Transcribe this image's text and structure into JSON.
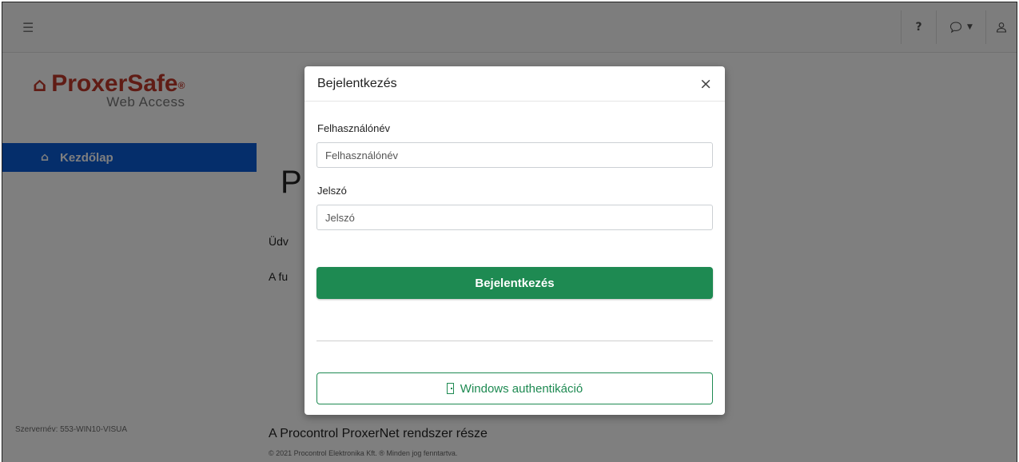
{
  "topbar": {
    "menu_icon": "hamburger-icon",
    "help_label": "?",
    "chat_icon": "chat-bubble-icon",
    "user_icon": "user-icon"
  },
  "sidebar": {
    "logo_main": "ProxerSafe",
    "logo_reg": "®",
    "logo_sub": "Web Access",
    "home_label": "Kezdőlap",
    "server_text": "Szervernév: 553-WIN10-VISUA"
  },
  "main": {
    "title_partial": "P",
    "welcome_partial": "Üdv",
    "func_partial": "A fu",
    "footer_main": "A Procontrol ProxerNet rendszer része",
    "footer_copy": "© 2021 Procontrol Elektronika Kft. ® Minden jog fenntartva."
  },
  "modal": {
    "title": "Bejelentkezés",
    "close_label": "×",
    "username_label": "Felhasználónév",
    "username_placeholder": "Felhasználónév",
    "username_value": "",
    "password_label": "Jelszó",
    "password_placeholder": "Jelszó",
    "password_value": "",
    "login_button": "Bejelentkezés",
    "windows_auth_button": "Windows authentikáció"
  },
  "colors": {
    "accent_blue": "#0b5cd6",
    "accent_green": "#1e8a52",
    "logo_red": "#c0392b"
  }
}
